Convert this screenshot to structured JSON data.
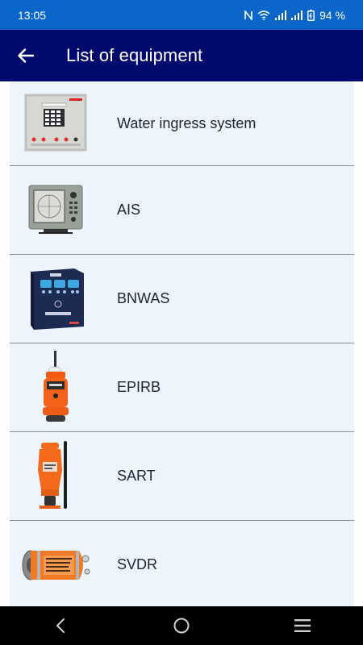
{
  "status_bar": {
    "time": "13:05",
    "battery": "94 %",
    "icons": [
      "nfc-icon",
      "wifi-icon",
      "signal-icon",
      "signal-icon",
      "battery-icon"
    ]
  },
  "app_bar": {
    "title": "List of equipment",
    "back_icon": "arrow-left-icon"
  },
  "equipment": [
    {
      "label": "Water ingress system"
    },
    {
      "label": "AIS"
    },
    {
      "label": "BNWAS"
    },
    {
      "label": "EPIRB"
    },
    {
      "label": "SART"
    },
    {
      "label": "SVDR"
    }
  ],
  "nav_bar": {
    "icons": [
      "back-icon",
      "home-icon",
      "recents-icon"
    ]
  },
  "colors": {
    "status_bar": "#0a66c8",
    "app_bar": "#030a6e",
    "list_background": "#edf4fc",
    "nav_bar": "#000000"
  }
}
